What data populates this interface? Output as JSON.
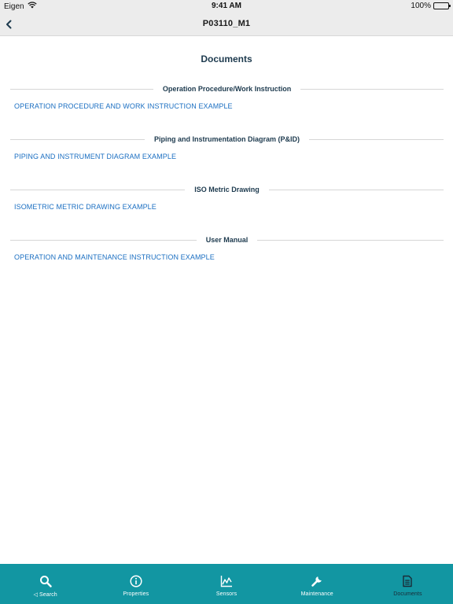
{
  "status_bar": {
    "carrier": "Eigen",
    "time": "9:41 AM",
    "battery": "100%"
  },
  "nav": {
    "title": "P03110_M1",
    "back_icon": "chevron-left-icon"
  },
  "main": {
    "title": "Documents",
    "sections": [
      {
        "header": "Operation Procedure/Work Instruction",
        "link": "OPERATION PROCEDURE AND WORK INSTRUCTION EXAMPLE"
      },
      {
        "header": "Piping and Instrumentation Diagram (P&ID)",
        "link": "PIPING AND INSTRUMENT DIAGRAM EXAMPLE"
      },
      {
        "header": "ISO Metric Drawing",
        "link": "ISOMETRIC METRIC DRAWING EXAMPLE"
      },
      {
        "header": "User Manual",
        "link": "OPERATION AND MAINTENANCE INSTRUCTION EXAMPLE"
      }
    ]
  },
  "tab_bar": {
    "tabs": [
      {
        "label": "Search",
        "icon": "search-icon",
        "active": false
      },
      {
        "label": "Properties",
        "icon": "info-icon",
        "active": false
      },
      {
        "label": "Sensors",
        "icon": "chart-icon",
        "active": false
      },
      {
        "label": "Maintenance",
        "icon": "wrench-icon",
        "active": false
      },
      {
        "label": "Documents",
        "icon": "document-icon",
        "active": true
      }
    ]
  },
  "colors": {
    "tab_bar_bg": "#1296a2",
    "link": "#1b6fc2",
    "heading": "#1d3a4e"
  }
}
